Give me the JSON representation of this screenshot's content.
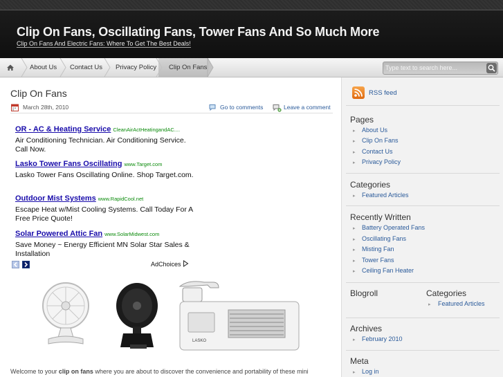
{
  "header": {
    "title": "Clip On Fans, Oscillating Fans, Tower Fans And So Much More",
    "description": "Clip On Fans And Electric Fans: Where To Get The Best Deals!"
  },
  "nav": {
    "home_icon": "home-icon",
    "items": [
      "About Us",
      "Contact Us",
      "Privacy Policy",
      "Clip On Fans"
    ],
    "search_placeholder": "Type text to search here..."
  },
  "post": {
    "title": "Clip On Fans",
    "date": "March 28th, 2010",
    "comments_link": "Go to comments",
    "leave_comment": "Leave a comment",
    "intro_prefix": "Welcome to your ",
    "intro_bold": "clip on fans",
    "intro_suffix": " where you are about to discover the convenience and portability of these mini"
  },
  "ads": [
    {
      "title": "OR - AC & Heating Service",
      "url": "CleanAirActHeatingandAC....",
      "desc": "Air Conditioning Technician. Air Conditioning Service. Call Now."
    },
    {
      "title": "Lasko Tower Fans Oscillating",
      "url": "www.Target.com",
      "desc": "Lasko Tower Fans Oscillating Online. Shop Target.com."
    },
    {
      "title": "Outdoor Mist Systems",
      "url": "www.RapidCool.net",
      "desc": "Escape Heat w/Mist Cooling Systems. Call Today For A Free Price Quote!"
    },
    {
      "title": "Solar Powered Attic Fan",
      "url": "www.SolarMidwest.com",
      "desc": "Save Money ~ Energy Efficient MN Solar Star Sales & Installation"
    }
  ],
  "adchoices": "AdChoices",
  "product_brand": "LASKO",
  "sidebar": {
    "rss": "RSS feed",
    "pages_title": "Pages",
    "pages": [
      "About Us",
      "Clip On Fans",
      "Contact Us",
      "Privacy Policy"
    ],
    "categories_title": "Categories",
    "categories": [
      "Featured Articles"
    ],
    "recent_title": "Recently Written",
    "recent": [
      "Battery Operated Fans",
      "Oscillating Fans",
      "Misting Fan",
      "Tower Fans",
      "Ceiling Fan Heater"
    ],
    "blogroll_title": "Blogroll",
    "categories2_title": "Categories",
    "categories2": [
      "Featured Articles"
    ],
    "archives_title": "Archives",
    "archives": [
      "February 2010"
    ],
    "meta_title": "Meta",
    "meta": [
      "Log in"
    ]
  },
  "colors": {
    "link": "#2a5a9a",
    "ad_title": "#1a0dab",
    "ad_url": "#0a8a0a",
    "header_bg": "#111111"
  }
}
